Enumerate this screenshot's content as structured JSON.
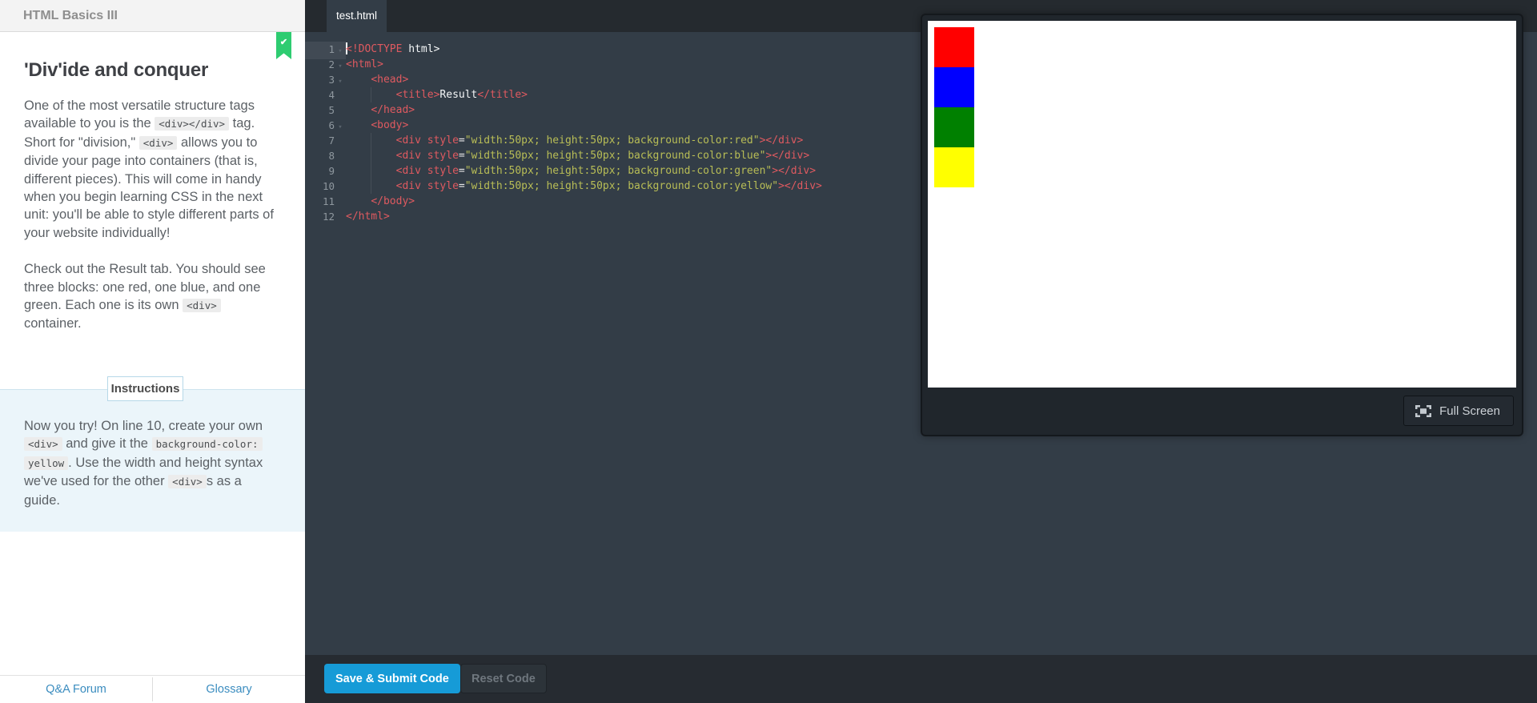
{
  "sidebar": {
    "header_title": "HTML Basics III",
    "lesson_title": "'Div'ide and conquer",
    "paragraphs": [
      {
        "segments": [
          {
            "t": "One of the most versatile structure tags available to you is the "
          },
          {
            "t": "<div></div>",
            "code": true
          },
          {
            "t": " tag. Short for \"division,\" "
          },
          {
            "t": "<div>",
            "code": true
          },
          {
            "t": " allows you to divide your page into containers (that is, different pieces). This will come in handy when you begin learning CSS in the next unit: you'll be able to style different parts of your website individually!"
          }
        ]
      },
      {
        "segments": [
          {
            "t": "Check out the Result tab. You should see three blocks: one red, one blue, and one green. Each one is its own "
          },
          {
            "t": "<div>",
            "code": true
          },
          {
            "t": " container."
          }
        ]
      }
    ],
    "instructions_label": "Instructions",
    "instructions": {
      "segments": [
        {
          "t": "Now you try! On line 10, create your own "
        },
        {
          "t": "<div>",
          "code": true
        },
        {
          "t": " and give it the "
        },
        {
          "t": "background-color:",
          "code": true
        },
        {
          "t": " "
        },
        {
          "t": "yellow",
          "code": true
        },
        {
          "t": ". Use the width and height syntax we've used for the other "
        },
        {
          "t": "<div>",
          "code": true
        },
        {
          "t": "s as a guide."
        }
      ]
    },
    "footer_links": [
      "Q&A Forum",
      "Glossary"
    ]
  },
  "editor": {
    "tab": "test.html",
    "lines": [
      {
        "n": 1,
        "fold": true,
        "cursor": true,
        "indent": 0,
        "tokens": [
          {
            "c": "tag",
            "t": "<!DOCTYPE"
          },
          {
            "c": "plain",
            "t": " html>"
          }
        ]
      },
      {
        "n": 2,
        "fold": true,
        "indent": 0,
        "tokens": [
          {
            "c": "tag",
            "t": "<html>"
          }
        ]
      },
      {
        "n": 3,
        "fold": true,
        "indent": 4,
        "tokens": [
          {
            "c": "tag",
            "t": "<head>"
          }
        ]
      },
      {
        "n": 4,
        "guide": true,
        "indent": 8,
        "tokens": [
          {
            "c": "tag",
            "t": "<title>"
          },
          {
            "c": "plain",
            "t": "Result"
          },
          {
            "c": "tag",
            "t": "</title>"
          }
        ]
      },
      {
        "n": 5,
        "indent": 4,
        "tokens": [
          {
            "c": "tag",
            "t": "</head>"
          }
        ]
      },
      {
        "n": 6,
        "fold": true,
        "indent": 4,
        "tokens": [
          {
            "c": "tag",
            "t": "<body>"
          }
        ]
      },
      {
        "n": 7,
        "guide": true,
        "indent": 8,
        "tokens": [
          {
            "c": "tag",
            "t": "<div style"
          },
          {
            "c": "eq",
            "t": "="
          },
          {
            "c": "str",
            "t": "\"width:50px; height:50px; background-color:red\""
          },
          {
            "c": "tag",
            "t": "></div>"
          }
        ]
      },
      {
        "n": 8,
        "guide": true,
        "indent": 8,
        "tokens": [
          {
            "c": "tag",
            "t": "<div style"
          },
          {
            "c": "eq",
            "t": "="
          },
          {
            "c": "str",
            "t": "\"width:50px; height:50px; background-color:blue\""
          },
          {
            "c": "tag",
            "t": "></div>"
          }
        ]
      },
      {
        "n": 9,
        "guide": true,
        "indent": 8,
        "tokens": [
          {
            "c": "tag",
            "t": "<div style"
          },
          {
            "c": "eq",
            "t": "="
          },
          {
            "c": "str",
            "t": "\"width:50px; height:50px; background-color:green\""
          },
          {
            "c": "tag",
            "t": "></div>"
          }
        ]
      },
      {
        "n": 10,
        "guide": true,
        "indent": 8,
        "tokens": [
          {
            "c": "tag",
            "t": "<div style"
          },
          {
            "c": "eq",
            "t": "="
          },
          {
            "c": "str",
            "t": "\"width:50px; height:50px; background-color:yellow\""
          },
          {
            "c": "tag",
            "t": "></div>"
          }
        ]
      },
      {
        "n": 11,
        "indent": 4,
        "tokens": [
          {
            "c": "tag",
            "t": "</body>"
          }
        ]
      },
      {
        "n": 12,
        "indent": 0,
        "tokens": [
          {
            "c": "tag",
            "t": "</html>"
          }
        ]
      }
    ]
  },
  "actions": {
    "save_label": "Save & Submit Code",
    "reset_label": "Reset Code"
  },
  "preview": {
    "fullscreen_label": "Full Screen",
    "squares": [
      {
        "color": "red",
        "hex": "#ff0000"
      },
      {
        "color": "blue",
        "hex": "#0000ff"
      },
      {
        "color": "green",
        "hex": "#008000"
      },
      {
        "color": "yellow",
        "hex": "#ffff00"
      }
    ]
  },
  "colors": {
    "accent_blue": "#169bd7",
    "bookmark_green": "#2ecc71",
    "editor_bg": "#333d47",
    "tag_red": "#df5a60",
    "string_olive": "#b8bd56"
  }
}
